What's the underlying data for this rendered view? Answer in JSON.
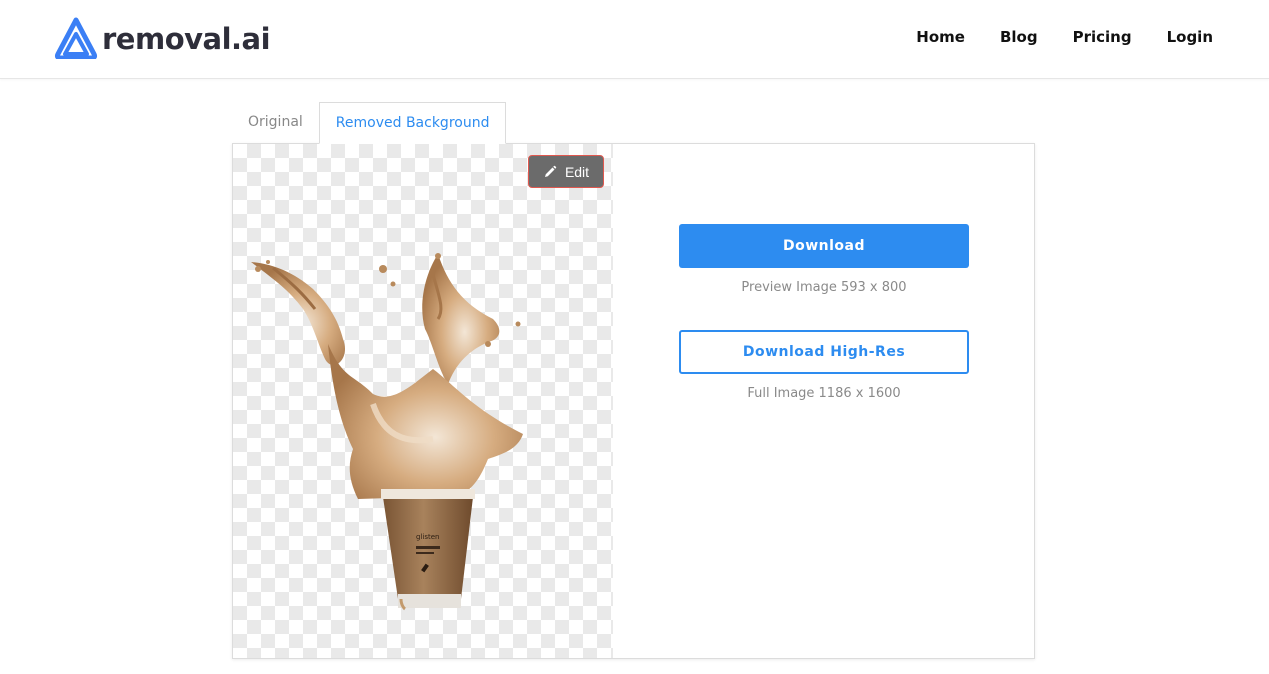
{
  "header": {
    "logo_text": "removal.ai",
    "nav": [
      {
        "label": "Home"
      },
      {
        "label": "Blog"
      },
      {
        "label": "Pricing"
      },
      {
        "label": "Login"
      }
    ]
  },
  "tabs": [
    {
      "label": "Original",
      "active": false
    },
    {
      "label": "Removed Background",
      "active": true
    }
  ],
  "preview": {
    "edit_label": "Edit",
    "cup_text": "glisten"
  },
  "actions": {
    "download_label": "Download",
    "preview_caption": "Preview Image 593 x 800",
    "download_hires_label": "Download High-Res",
    "full_caption": "Full Image 1186 x 1600"
  },
  "colors": {
    "accent": "#2d8cf0",
    "logo_blue": "#3b7ff5",
    "edit_bg": "#6b6b6b"
  }
}
